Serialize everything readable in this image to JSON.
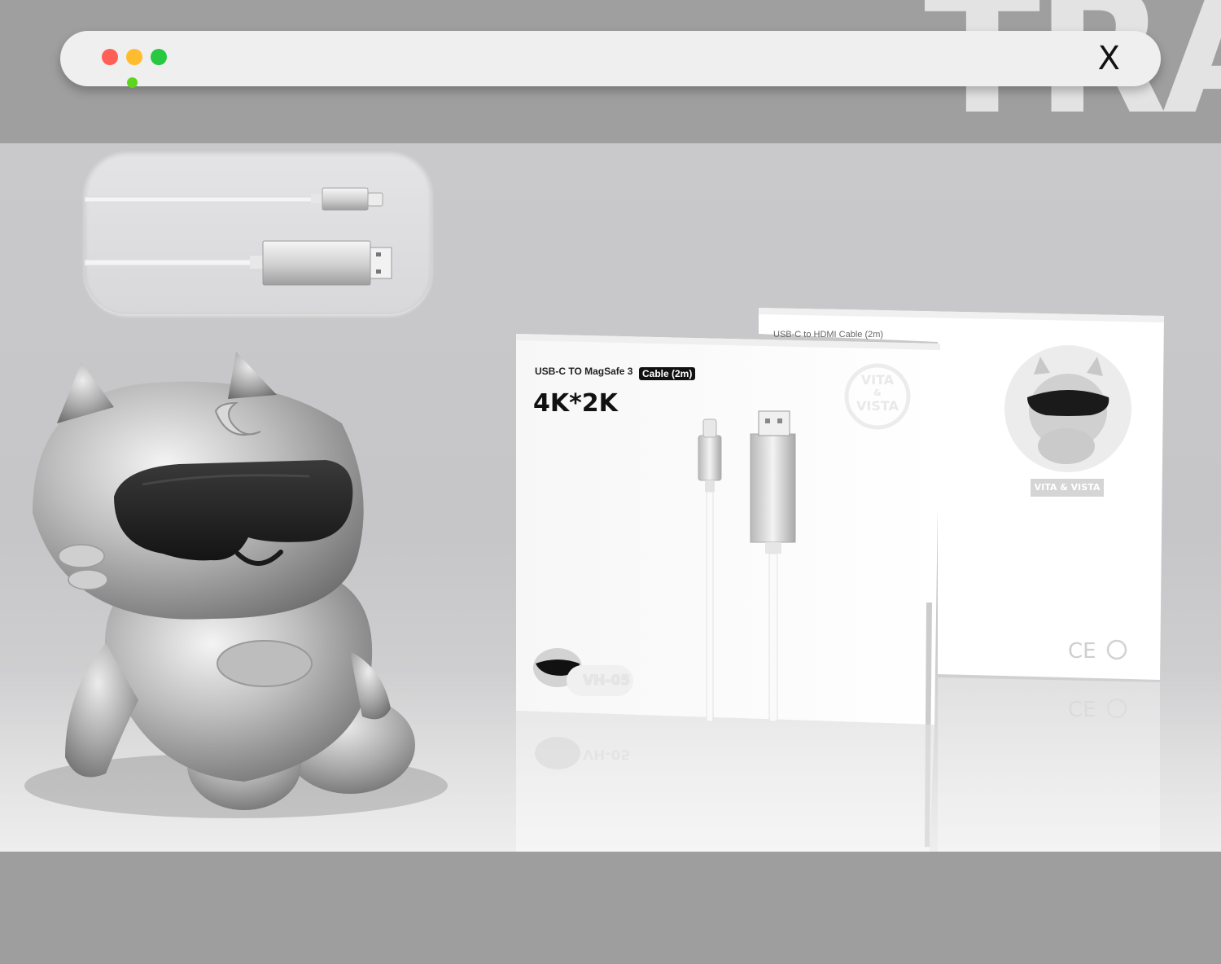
{
  "window": {
    "close_label": "X",
    "watermark_text": "TRA",
    "traffic_colors": {
      "red": "#fe5f57",
      "yellow": "#febc2e",
      "green": "#28c840"
    }
  },
  "package_front": {
    "product_line": "USB-C TO MagSafe 3",
    "badge": "Cable (2m)",
    "resolution": "4K*2K",
    "model": "VH-05",
    "seal_top": "VITA",
    "seal_mid": "&",
    "seal_bottom": "VISTA"
  },
  "package_back": {
    "product_line": "USB-C to HDMI Cable (2m)",
    "brand": "VITA & VISTA",
    "cert_marks": "CE"
  },
  "icons": [
    "close-icon",
    "usb-c-cable-icon",
    "hdmi-cable-icon",
    "recycle-icon",
    "mascot-figure"
  ]
}
